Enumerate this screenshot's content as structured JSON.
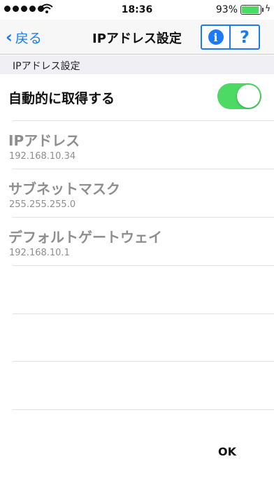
{
  "status": {
    "time": "18:36",
    "battery_percent": "93%",
    "battery_level": 0.93
  },
  "nav": {
    "back_label": "戻る",
    "title": "IPアドレス設定",
    "info_glyph": "i",
    "help_glyph": "?"
  },
  "section": {
    "header": "IPアドレス設定"
  },
  "auto_obtain": {
    "label": "自動的に取得する",
    "enabled": true
  },
  "fields": [
    {
      "label": "IPアドレス",
      "value": "192.168.10.34"
    },
    {
      "label": "サブネットマスク",
      "value": "255.255.255.0"
    },
    {
      "label": "デフォルトゲートウェイ",
      "value": "192.168.10.1"
    }
  ],
  "footer": {
    "ok_label": "OK"
  },
  "colors": {
    "accent": "#1a7af8",
    "switch_on": "#4cd964",
    "disabled_text": "#8e8e8e"
  }
}
